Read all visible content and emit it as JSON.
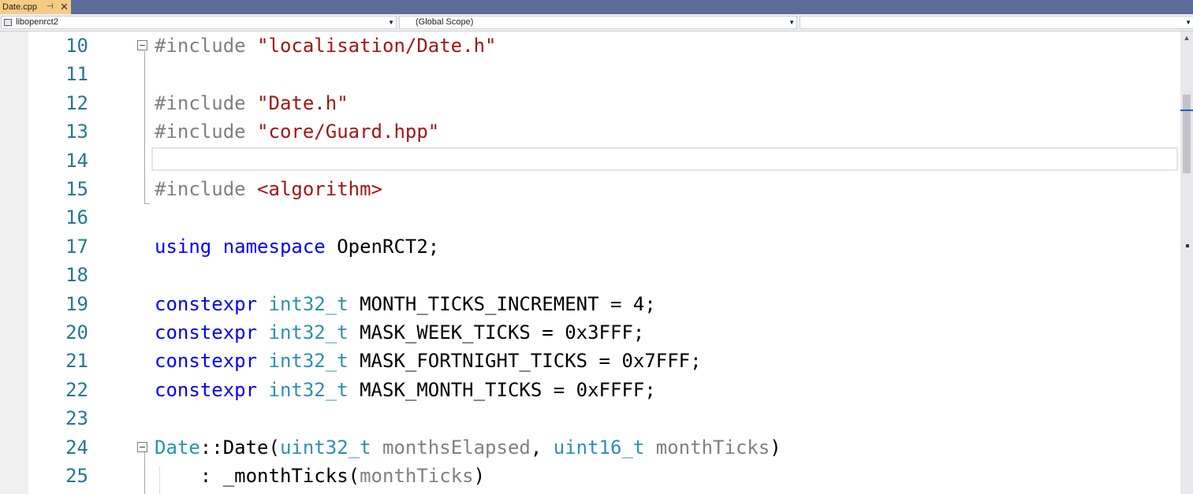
{
  "tab": {
    "title": "Date.cpp",
    "pin": "⊣",
    "close": "✕"
  },
  "nav": {
    "project": "libopenrct2",
    "scope": "(Global Scope)",
    "member": ""
  },
  "lines": [
    {
      "num": "10",
      "tokens": [
        {
          "c": "pp",
          "t": "#include "
        },
        {
          "c": "str",
          "t": "\"localisation/Date.h\""
        }
      ]
    },
    {
      "num": "11",
      "tokens": []
    },
    {
      "num": "12",
      "tokens": [
        {
          "c": "pp",
          "t": "#include "
        },
        {
          "c": "str",
          "t": "\"Date.h\""
        }
      ]
    },
    {
      "num": "13",
      "tokens": [
        {
          "c": "pp",
          "t": "#include "
        },
        {
          "c": "str",
          "t": "\"core/Guard.hpp\""
        }
      ]
    },
    {
      "num": "14",
      "tokens": []
    },
    {
      "num": "15",
      "tokens": [
        {
          "c": "pp",
          "t": "#include "
        },
        {
          "c": "str",
          "t": "<algorithm>"
        }
      ]
    },
    {
      "num": "16",
      "tokens": []
    },
    {
      "num": "17",
      "tokens": [
        {
          "c": "kw",
          "t": "using"
        },
        {
          "c": "id",
          "t": " "
        },
        {
          "c": "kw",
          "t": "namespace"
        },
        {
          "c": "id",
          "t": " OpenRCT2;"
        }
      ]
    },
    {
      "num": "18",
      "tokens": []
    },
    {
      "num": "19",
      "tokens": [
        {
          "c": "kw",
          "t": "constexpr"
        },
        {
          "c": "id",
          "t": " "
        },
        {
          "c": "ty",
          "t": "int32_t"
        },
        {
          "c": "id",
          "t": " MONTH_TICKS_INCREMENT = 4;"
        }
      ]
    },
    {
      "num": "20",
      "tokens": [
        {
          "c": "kw",
          "t": "constexpr"
        },
        {
          "c": "id",
          "t": " "
        },
        {
          "c": "ty",
          "t": "int32_t"
        },
        {
          "c": "id",
          "t": " MASK_WEEK_TICKS = 0x3FFF;"
        }
      ]
    },
    {
      "num": "21",
      "tokens": [
        {
          "c": "kw",
          "t": "constexpr"
        },
        {
          "c": "id",
          "t": " "
        },
        {
          "c": "ty",
          "t": "int32_t"
        },
        {
          "c": "id",
          "t": " MASK_FORTNIGHT_TICKS = 0x7FFF;"
        }
      ]
    },
    {
      "num": "22",
      "tokens": [
        {
          "c": "kw",
          "t": "constexpr"
        },
        {
          "c": "id",
          "t": " "
        },
        {
          "c": "ty",
          "t": "int32_t"
        },
        {
          "c": "id",
          "t": " MASK_MONTH_TICKS = 0xFFFF;"
        }
      ]
    },
    {
      "num": "23",
      "tokens": []
    },
    {
      "num": "24",
      "tokens": [
        {
          "c": "ty",
          "t": "Date"
        },
        {
          "c": "id",
          "t": "::Date("
        },
        {
          "c": "ty",
          "t": "uint32_t"
        },
        {
          "c": "id",
          "t": " "
        },
        {
          "c": "prm",
          "t": "monthsElapsed"
        },
        {
          "c": "id",
          "t": ", "
        },
        {
          "c": "ty",
          "t": "uint16_t"
        },
        {
          "c": "id",
          "t": " "
        },
        {
          "c": "prm",
          "t": "monthTicks"
        },
        {
          "c": "id",
          "t": ")"
        }
      ]
    },
    {
      "num": "25",
      "tokens": [
        {
          "c": "id",
          "t": "    : _monthTicks("
        },
        {
          "c": "prm",
          "t": "monthTicks"
        },
        {
          "c": "id",
          "t": ")"
        }
      ]
    }
  ]
}
